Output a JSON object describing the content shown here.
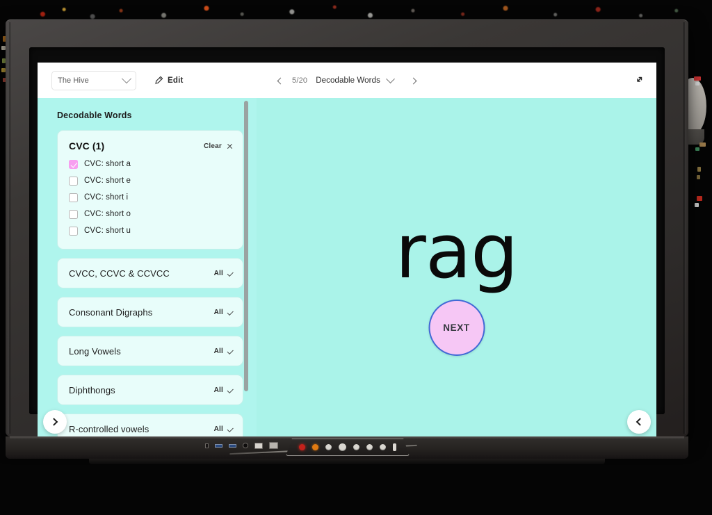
{
  "toolbar": {
    "class_selector_value": "The Hive",
    "class_selector_icon": "chevron-down-icon",
    "edit_label": "Edit",
    "edit_icon": "pencil-marker-icon",
    "prev_icon": "chevron-left-icon",
    "next_icon": "chevron-right-icon",
    "page_counter": "5/20",
    "deck_title": "Decodable Words",
    "deck_dropdown_icon": "chevron-down-icon",
    "collapse_icon": "collapse-diagonal-arrows-icon"
  },
  "sidebar": {
    "title": "Decodable Words",
    "groups": [
      {
        "name": "CVC (1)",
        "expanded": true,
        "clear_label": "Clear",
        "clear_close_icon": "close-x-icon",
        "options": [
          {
            "label": "CVC: short a",
            "checked": true
          },
          {
            "label": "CVC: short e",
            "checked": false
          },
          {
            "label": "CVC: short i",
            "checked": false
          },
          {
            "label": "CVC: short o",
            "checked": false
          },
          {
            "label": "CVC: short u",
            "checked": false
          }
        ]
      },
      {
        "name": "CVCC, CCVC & CCVCC",
        "expanded": false,
        "all_label": "All",
        "all_icon": "check-tick-icon"
      },
      {
        "name": "Consonant Digraphs",
        "expanded": false,
        "all_label": "All",
        "all_icon": "check-tick-icon"
      },
      {
        "name": "Long Vowels",
        "expanded": false,
        "all_label": "All",
        "all_icon": "check-tick-icon"
      },
      {
        "name": "Diphthongs",
        "expanded": false,
        "all_label": "All",
        "all_icon": "check-tick-icon"
      },
      {
        "name": "R-controlled vowels",
        "expanded": false,
        "all_label": "All",
        "all_icon": "check-tick-icon"
      }
    ]
  },
  "stage": {
    "word": "rag",
    "next_label": "NEXT"
  },
  "corner_controls": {
    "bottom_left_icon": "chevron-right-icon",
    "bottom_right_icon": "chevron-left-icon"
  },
  "colors": {
    "screen_background": "#aff5ed",
    "stage_background": "#aaf3e9",
    "card_background": "#e8fdfa",
    "checkbox_checked": "#f79ff0",
    "next_button_fill": "#f6c7f5",
    "next_button_border": "#4169d6",
    "toolbar_background": "#ffffff",
    "scrollbar_thumb": "#9aa3a2"
  },
  "hardware": {
    "power_button_color": "#c4211b",
    "indicator_color": "#e07a12"
  }
}
